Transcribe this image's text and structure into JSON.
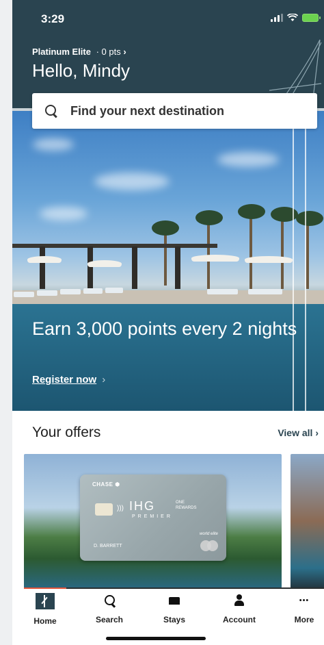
{
  "status_bar": {
    "time": "3:29"
  },
  "header": {
    "tier": "Platinum Elite",
    "points": "· 0 pts",
    "points_chevron": "›",
    "greeting": "Hello, Mindy"
  },
  "search": {
    "placeholder": "Find your next destination"
  },
  "hero": {
    "title": "Earn 3,000 points every 2 nights",
    "link": "Register now",
    "link_chevron": "›"
  },
  "offers": {
    "heading": "Your offers",
    "view_all": "View all ›",
    "card": {
      "bank": "CHASE ⬢",
      "brand": "IHG",
      "brand_sub_1": "ONE",
      "brand_sub_2": "REWARDS",
      "product": "PREMIER",
      "tier": "world elite",
      "cardholder": "D. BARRETT",
      "network": "mastercard"
    }
  },
  "tabbar": {
    "items": [
      {
        "label": "Home",
        "icon": "home-icon"
      },
      {
        "label": "Search",
        "icon": "search-icon"
      },
      {
        "label": "Stays",
        "icon": "bed-icon"
      },
      {
        "label": "Account",
        "icon": "person-icon"
      },
      {
        "label": "More",
        "icon": "more-icon"
      }
    ],
    "more_glyph": "•••"
  },
  "colors": {
    "header_bg": "#2a4450",
    "accent": "#e2543a",
    "battery": "#6bd24f"
  }
}
